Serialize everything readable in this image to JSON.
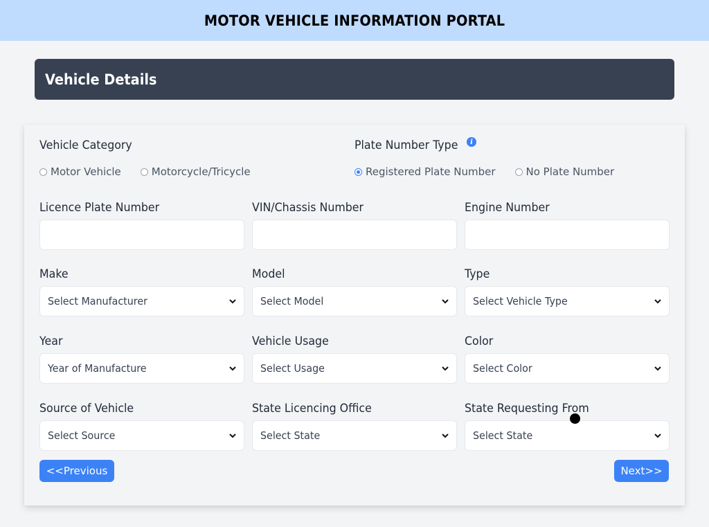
{
  "header": {
    "title": "MOTOR VEHICLE INFORMATION PORTAL"
  },
  "section": {
    "title": "Vehicle Details"
  },
  "form": {
    "vehicle_category": {
      "label": "Vehicle Category",
      "options": [
        {
          "label": "Motor Vehicle",
          "checked": false
        },
        {
          "label": "Motorcycle/Tricycle",
          "checked": false
        }
      ]
    },
    "plate_number_type": {
      "label": "Plate Number Type",
      "info_icon": "i",
      "options": [
        {
          "label": "Registered Plate Number",
          "checked": true
        },
        {
          "label": "No Plate Number",
          "checked": false
        }
      ]
    },
    "licence_plate": {
      "label": "Licence Plate Number",
      "value": ""
    },
    "vin": {
      "label": "VIN/Chassis Number",
      "value": ""
    },
    "engine": {
      "label": "Engine Number",
      "value": ""
    },
    "make": {
      "label": "Make",
      "selected": "Select Manufacturer"
    },
    "model": {
      "label": "Model",
      "selected": "Select Model"
    },
    "type": {
      "label": "Type",
      "selected": "Select Vehicle Type"
    },
    "year": {
      "label": "Year",
      "selected": "Year of Manufacture"
    },
    "usage": {
      "label": "Vehicle Usage",
      "selected": "Select Usage"
    },
    "color": {
      "label": "Color",
      "selected": "Select Color"
    },
    "source": {
      "label": "Source of Vehicle",
      "selected": "Select Source"
    },
    "licencing_office": {
      "label": "State Licencing Office",
      "selected": "Select State"
    },
    "requesting_from": {
      "label": "State Requesting From",
      "selected": "Select State"
    }
  },
  "buttons": {
    "previous": "<<Previous",
    "next": "Next>>"
  },
  "colors": {
    "accent": "#3b82f6",
    "header_bg": "#bfdbfe",
    "section_bg": "#374151"
  }
}
